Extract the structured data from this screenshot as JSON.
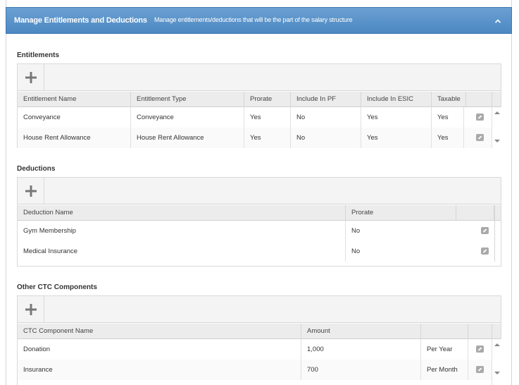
{
  "header": {
    "title": "Manage Entitlements and Deductions",
    "description": "Manage entitlements/deductions that will be the part of the salary structure"
  },
  "entitlements": {
    "title": "Entitlements",
    "columns": [
      "Entitlement Name",
      "Entitlement Type",
      "Prorate",
      "Include In PF",
      "Include In ESIC",
      "Taxable"
    ],
    "rows": [
      [
        "Conveyance",
        "Conveyance",
        "Yes",
        "No",
        "Yes",
        "Yes"
      ],
      [
        "House Rent Allowance",
        "House Rent Allowance",
        "Yes",
        "No",
        "Yes",
        "Yes"
      ]
    ]
  },
  "deductions": {
    "title": "Deductions",
    "columns": [
      "Deduction Name",
      "Prorate"
    ],
    "rows": [
      [
        "Gym Membership",
        "No"
      ],
      [
        "Medical Insurance",
        "No"
      ]
    ]
  },
  "ctc": {
    "title": "Other CTC Components",
    "columns": [
      "CTC Component Name",
      "Amount"
    ],
    "rows": [
      [
        "Donation",
        "1,000",
        "Per Year"
      ],
      [
        "Insurance",
        "700",
        "Per Month"
      ]
    ]
  },
  "icons": {
    "add": "plus-icon",
    "edit": "pencil-icon",
    "collapse": "chevron-up-icon"
  },
  "colors": {
    "header_bg": "#5590c8",
    "toolbar_bg": "#f4f4f4",
    "header_row_bg": "#ececec"
  }
}
